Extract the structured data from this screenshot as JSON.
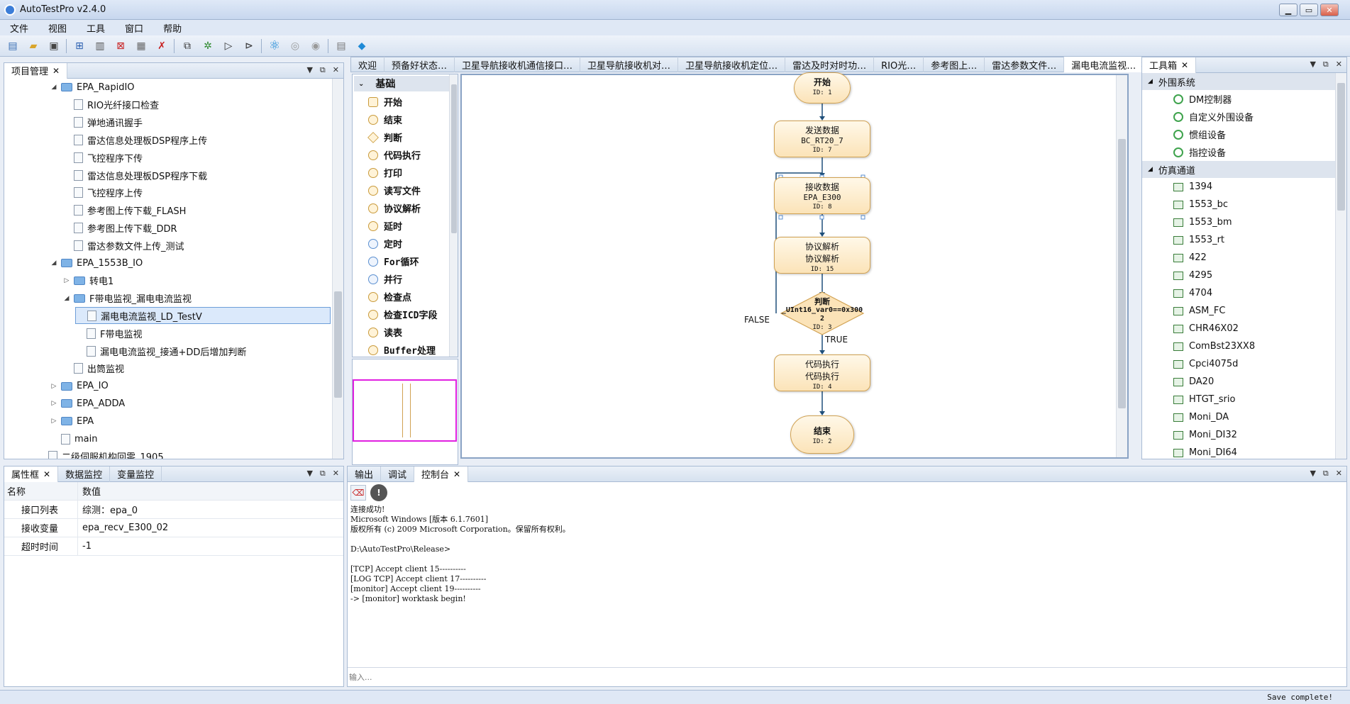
{
  "window": {
    "title": "AutoTestPro v2.4.0"
  },
  "menu": [
    "文件",
    "视图",
    "工具",
    "窗口",
    "帮助"
  ],
  "project_panel": {
    "tab": "项目管理",
    "tree": [
      {
        "label": "EPA_RapidIO",
        "level": 0,
        "type": "folder",
        "expanded": true
      },
      {
        "label": "RIO光纤接口检查",
        "level": 1,
        "type": "file"
      },
      {
        "label": "弹地通讯握手",
        "level": 1,
        "type": "file"
      },
      {
        "label": "雷达信息处理板DSP程序上传",
        "level": 1,
        "type": "file"
      },
      {
        "label": "飞控程序下传",
        "level": 1,
        "type": "file"
      },
      {
        "label": "雷达信息处理板DSP程序下载",
        "level": 1,
        "type": "file"
      },
      {
        "label": "飞控程序上传",
        "level": 1,
        "type": "file"
      },
      {
        "label": "参考图上传下载_FLASH",
        "level": 1,
        "type": "file"
      },
      {
        "label": "参考图上传下载_DDR",
        "level": 1,
        "type": "file"
      },
      {
        "label": "雷达参数文件上传_测试",
        "level": 1,
        "type": "file"
      },
      {
        "label": "EPA_1553B_IO",
        "level": 0,
        "type": "folder",
        "expanded": true
      },
      {
        "label": "转电1",
        "level": 1,
        "type": "folder",
        "expanded": false
      },
      {
        "label": "F带电监视_漏电电流监视",
        "level": 1,
        "type": "folder",
        "expanded": true
      },
      {
        "label": "漏电电流监视_LD_TestV",
        "level": 2,
        "type": "file",
        "selected": true
      },
      {
        "label": "F带电监视",
        "level": 2,
        "type": "file"
      },
      {
        "label": "漏电电流监视_接通+DD后增加判断",
        "level": 2,
        "type": "file"
      },
      {
        "label": "出筒监视",
        "level": 1,
        "type": "file"
      },
      {
        "label": "EPA_IO",
        "level": 0,
        "type": "folder",
        "expanded": false
      },
      {
        "label": "EPA_ADDA",
        "level": 0,
        "type": "folder",
        "expanded": false
      },
      {
        "label": "EPA",
        "level": 0,
        "type": "folder",
        "expanded": false
      },
      {
        "label": "main",
        "level": 0,
        "type": "file"
      },
      {
        "label": "二级伺服机构回零_1905",
        "level": -1,
        "type": "file"
      }
    ]
  },
  "props_panel": {
    "tabs": [
      "属性框",
      "数据监控",
      "变量监控"
    ],
    "header": {
      "name": "名称",
      "value": "数值"
    },
    "rows": [
      {
        "name": "接口列表",
        "value": "综测：epa_0"
      },
      {
        "name": "接收变量",
        "value": "epa_recv_E300_02"
      },
      {
        "name": "超时时间",
        "value": "-1"
      }
    ]
  },
  "editor_tabs": [
    "欢迎",
    "预备好状态…",
    "卫星导航接收机通信接口…",
    "卫星导航接收机对…",
    "卫星导航接收机定位…",
    "雷达及时对时功…",
    "RIO光…",
    "参考图上…",
    "雷达参数文件…",
    "漏电电流监视…"
  ],
  "palette": {
    "group": "基础",
    "items": [
      "开始",
      "结束",
      "判断",
      "代码执行",
      "打印",
      "读写文件",
      "协议解析",
      "延时",
      "定时",
      "For循环",
      "并行",
      "检查点",
      "检查ICD字段",
      "读表",
      "Buffer处理"
    ]
  },
  "flow": {
    "nodes": [
      {
        "title": "开始",
        "sub": "",
        "id": "ID: 1"
      },
      {
        "title": "发送数据",
        "sub": "BC_RT20_7",
        "id": "ID: 7"
      },
      {
        "title": "接收数据",
        "sub": "EPA_E300",
        "id": "ID: 8"
      },
      {
        "title": "协议解析",
        "sub": "协议解析",
        "id": "ID: 15"
      },
      {
        "title": "判断",
        "sub": "_UInt16_var0==0x3002",
        "id": "ID: 3"
      },
      {
        "title": "代码执行",
        "sub": "代码执行",
        "id": "ID: 4"
      },
      {
        "title": "结束",
        "sub": "",
        "id": "ID: 2"
      }
    ],
    "false_label": "FALSE",
    "true_label": "TRUE"
  },
  "toolbox": {
    "tab": "工具箱",
    "groups": [
      {
        "name": "外围系统",
        "items": [
          "DM控制器",
          "自定义外围设备",
          "惯组设备",
          "指控设备"
        ]
      },
      {
        "name": "仿真通道",
        "items": [
          "1394",
          "1553_bc",
          "1553_bm",
          "1553_rt",
          "422",
          "4295",
          "4704",
          "ASM_FC",
          "CHR46X02",
          "ComBst23XX8",
          "Cpci4075d",
          "DA20",
          "HTGT_srio",
          "Moni_DA",
          "Moni_DI32",
          "Moni_DI64"
        ]
      }
    ]
  },
  "console": {
    "tabs": [
      "输出",
      "调试",
      "控制台"
    ],
    "text": "连接成功!\nMicrosoft Windows [版本 6.1.7601]\n版权所有 (c) 2009 Microsoft Corporation。保留所有权利。\n\nD:\\AutoTestPro\\Release>\n\n[TCP] Accept client 15----------\n[LOG TCP] Accept client 17----------\n[monitor] Accept client 19----------\n-> [monitor] worktask begin!",
    "input_placeholder": "输入..."
  },
  "status": {
    "text": "Save complete!"
  },
  "colors": {
    "accent": "#3b7dd8",
    "node_fill": "#fbe3b8",
    "node_border": "#d1a253",
    "selection": "#dbe9fb",
    "overview_border": "#e020e0"
  }
}
